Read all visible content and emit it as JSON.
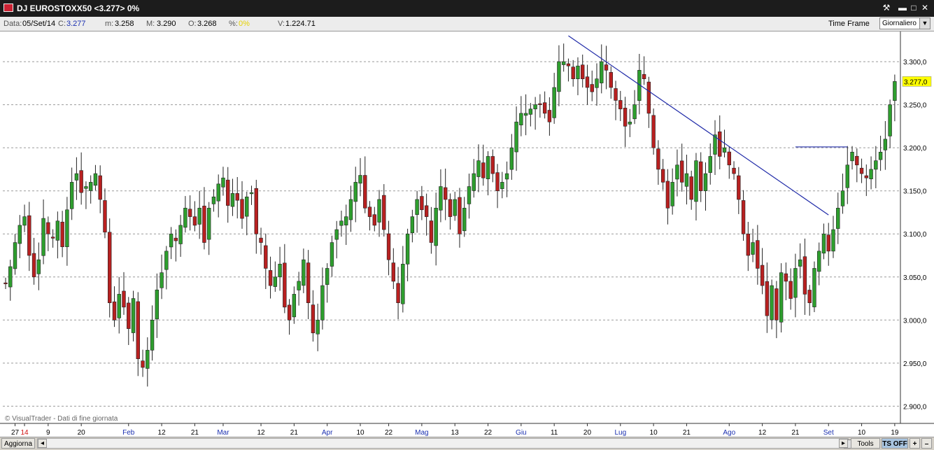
{
  "window": {
    "title": "DJ EUROSTOXX50 <3.277> 0%",
    "buttons": [
      "tools-icon",
      "minimize-icon",
      "maximize-icon",
      "close-icon"
    ]
  },
  "info": {
    "data_label": "Data:",
    "data_value": "05/Set/14",
    "c_label": "C:",
    "c_value": "3.277",
    "m_label": "m:",
    "m_value": "3.258",
    "M_label": "M:",
    "M_value": "3.290",
    "o_label": "O:",
    "o_value": "3.268",
    "pct_label": "%:",
    "pct_value": "0%",
    "v_label": "V:",
    "v_value": "1.224.71",
    "time_frame_label": "Time Frame",
    "time_frame_value": "Giornaliero"
  },
  "colors": {
    "up": "#2e9e2e",
    "down": "#b82020",
    "grid": "#9a9a9a",
    "trendline": "#1f2aa8",
    "last_price_bg": "#ffff00",
    "month_label": "#1a2fb0",
    "year_label": "#d01010"
  },
  "watermark": "© VisualTrader - Dati di fine giornata",
  "bottom": {
    "aggiorna": "Aggiorna",
    "tools": "Tools",
    "ts_off": "TS OFF",
    "plus": "+",
    "minus": "–"
  },
  "chart_data": {
    "type": "candlestick",
    "y_ticks": [
      "2.900,0",
      "2.950,0",
      "3.000,0",
      "3.050,0",
      "3.100,0",
      "3.150,0",
      "3.200,0",
      "3.250,0",
      "3.300,0"
    ],
    "y_tick_values": [
      2900,
      2950,
      3000,
      3050,
      3100,
      3150,
      3200,
      3250,
      3300
    ],
    "ylim": [
      2880,
      3335
    ],
    "last_price_label": "3.277,0",
    "last_price": 3277,
    "x_labels": [
      {
        "text": "27",
        "type": "day",
        "bar": 2
      },
      {
        "text": "14",
        "type": "year",
        "bar": 4
      },
      {
        "text": "9",
        "type": "day",
        "bar": 9
      },
      {
        "text": "20",
        "type": "day",
        "bar": 16
      },
      {
        "text": "Feb",
        "type": "month",
        "bar": 26
      },
      {
        "text": "12",
        "type": "day",
        "bar": 33
      },
      {
        "text": "21",
        "type": "day",
        "bar": 40
      },
      {
        "text": "Mar",
        "type": "month",
        "bar": 46
      },
      {
        "text": "12",
        "type": "day",
        "bar": 54
      },
      {
        "text": "21",
        "type": "day",
        "bar": 61
      },
      {
        "text": "Apr",
        "type": "month",
        "bar": 68
      },
      {
        "text": "10",
        "type": "day",
        "bar": 75
      },
      {
        "text": "22",
        "type": "day",
        "bar": 81
      },
      {
        "text": "Mag",
        "type": "month",
        "bar": 88
      },
      {
        "text": "13",
        "type": "day",
        "bar": 95
      },
      {
        "text": "22",
        "type": "day",
        "bar": 102
      },
      {
        "text": "Giu",
        "type": "month",
        "bar": 109
      },
      {
        "text": "11",
        "type": "day",
        "bar": 116
      },
      {
        "text": "20",
        "type": "day",
        "bar": 123
      },
      {
        "text": "Lug",
        "type": "month",
        "bar": 130
      },
      {
        "text": "10",
        "type": "day",
        "bar": 137
      },
      {
        "text": "21",
        "type": "day",
        "bar": 144
      },
      {
        "text": "Ago",
        "type": "month",
        "bar": 153
      },
      {
        "text": "12",
        "type": "day",
        "bar": 160
      },
      {
        "text": "21",
        "type": "day",
        "bar": 167
      },
      {
        "text": "Set",
        "type": "month",
        "bar": 174
      },
      {
        "text": "10",
        "type": "day",
        "bar": 181
      },
      {
        "text": "19",
        "type": "day",
        "bar": 188
      }
    ],
    "bar_count": 191,
    "closes": [
      3042,
      3062,
      3090,
      3110,
      3120,
      3075,
      3050,
      3070,
      3118,
      3100,
      3095,
      3115,
      3085,
      3128,
      3160,
      3170,
      3148,
      3155,
      3160,
      3170,
      3140,
      3102,
      3020,
      3000,
      3030,
      3015,
      2990,
      3025,
      2955,
      2945,
      2965,
      3000,
      3035,
      3055,
      3080,
      3100,
      3092,
      3110,
      3130,
      3120,
      3110,
      3130,
      3090,
      3130,
      3143,
      3158,
      3165,
      3133,
      3147,
      3139,
      3118,
      3143,
      3148,
      3100,
      3090,
      3060,
      3040,
      3050,
      3065,
      3015,
      3000,
      3030,
      3045,
      3070,
      3020,
      2985,
      3000,
      3040,
      3060,
      3090,
      3105,
      3115,
      3120,
      3140,
      3160,
      3168,
      3130,
      3120,
      3110,
      3140,
      3105,
      3070,
      3045,
      3020,
      3065,
      3100,
      3120,
      3140,
      3128,
      3120,
      3090,
      3130,
      3155,
      3140,
      3120,
      3140,
      3100,
      3130,
      3155,
      3170,
      3185,
      3165,
      3190,
      3170,
      3150,
      3160,
      3170,
      3200,
      3230,
      3240,
      3240,
      3245,
      3250,
      3250,
      3240,
      3230,
      3270,
      3300,
      3300,
      3295,
      3280,
      3295,
      3280,
      3270,
      3265,
      3280,
      3300,
      3290,
      3270,
      3255,
      3245,
      3225,
      3230,
      3250,
      3290,
      3280,
      3240,
      3200,
      3175,
      3160,
      3130,
      3160,
      3180,
      3160,
      3170,
      3140,
      3185,
      3150,
      3170,
      3190,
      3215,
      3190,
      3200,
      3180,
      3170,
      3140,
      3100,
      3075,
      3090,
      3060,
      3040,
      3005,
      3040,
      3000,
      3055,
      3045,
      3025,
      3060,
      3070,
      3030,
      3020,
      3060,
      3080,
      3100,
      3080,
      3105,
      3130,
      3150,
      3180,
      3195,
      3180,
      3170,
      3165,
      3175,
      3185,
      3195,
      3210,
      3250,
      3277
    ],
    "trendline": {
      "from": [
        119,
        3330
      ],
      "to": [
        174,
        3122
      ]
    },
    "hline": {
      "value": 3201,
      "from": 167,
      "to": 178
    }
  }
}
